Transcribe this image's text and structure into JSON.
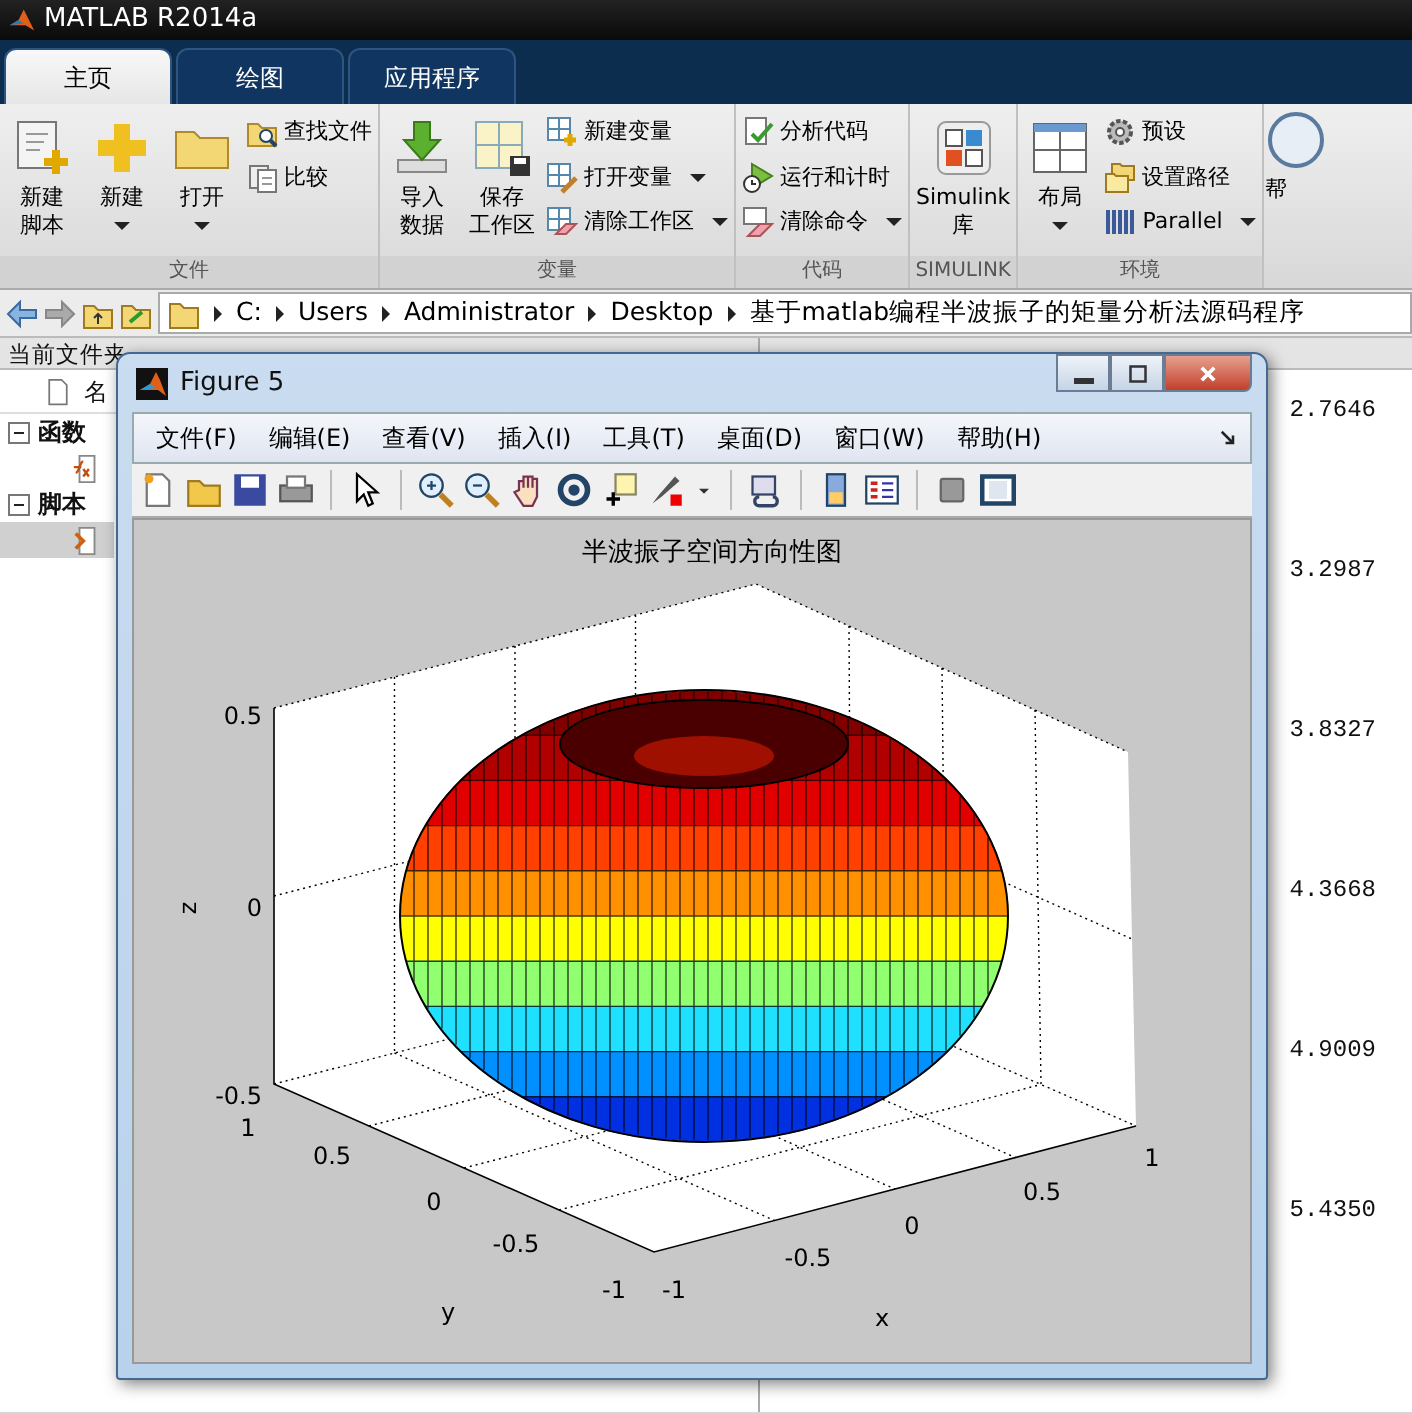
{
  "app_title": "MATLAB R2014a",
  "tabs": [
    {
      "label": "主页",
      "selected": true
    },
    {
      "label": "绘图",
      "selected": false
    },
    {
      "label": "应用程序",
      "selected": false
    }
  ],
  "ribbon": {
    "groups": [
      {
        "label": "文件",
        "columns": [
          [
            {
              "kind": "large",
              "lines": [
                "新建",
                "脚本"
              ],
              "dropdown": false
            }
          ],
          [
            {
              "kind": "large",
              "lines": [
                "新建"
              ],
              "dropdown": true
            }
          ],
          [
            {
              "kind": "large",
              "lines": [
                "打开"
              ],
              "dropdown": true
            }
          ],
          [
            {
              "kind": "small",
              "label": "查找文件",
              "dropdown": false
            },
            {
              "kind": "small",
              "label": "比较",
              "dropdown": false
            }
          ]
        ]
      },
      {
        "label": "变量",
        "columns": [
          [
            {
              "kind": "large",
              "lines": [
                "导入",
                "数据"
              ],
              "dropdown": false
            }
          ],
          [
            {
              "kind": "large",
              "lines": [
                "保存",
                "工作区"
              ],
              "dropdown": false
            }
          ],
          [
            {
              "kind": "small",
              "label": "新建变量",
              "dropdown": false
            },
            {
              "kind": "small",
              "label": "打开变量",
              "dropdown": true
            },
            {
              "kind": "small",
              "label": "清除工作区",
              "dropdown": true
            }
          ]
        ]
      },
      {
        "label": "代码",
        "columns": [
          [
            {
              "kind": "small",
              "label": "分析代码",
              "dropdown": false
            },
            {
              "kind": "small",
              "label": "运行和计时",
              "dropdown": false
            },
            {
              "kind": "small",
              "label": "清除命令",
              "dropdown": true
            }
          ]
        ]
      },
      {
        "label": "SIMULINK",
        "columns": [
          [
            {
              "kind": "large",
              "lines": [
                "Simulink",
                "库"
              ],
              "dropdown": false
            }
          ]
        ]
      },
      {
        "label": "环境",
        "columns": [
          [
            {
              "kind": "large",
              "lines": [
                "布局"
              ],
              "dropdown": true
            }
          ],
          [
            {
              "kind": "small",
              "label": "预设",
              "dropdown": false
            },
            {
              "kind": "small",
              "label": "设置路径",
              "dropdown": false
            },
            {
              "kind": "small",
              "label": "Parallel",
              "dropdown": true
            }
          ]
        ]
      }
    ],
    "cut_button": "帮"
  },
  "path": [
    "C:",
    "Users",
    "Administrator",
    "Desktop",
    "基于matlab编程半波振子的矩量分析法源码程序"
  ],
  "current_folder": {
    "title": "当前文件夹",
    "column": "名",
    "sections": [
      {
        "label": "函数",
        "expanded": true,
        "children": [
          {
            "kind": "function",
            "selected": false
          }
        ]
      },
      {
        "label": "脚本",
        "expanded": true,
        "children": [
          {
            "kind": "script",
            "selected": true
          }
        ]
      }
    ]
  },
  "command_window": {
    "values": [
      "2.7646",
      "3.2987",
      "3.8327",
      "4.3668",
      "4.9009",
      "5.4350"
    ]
  },
  "figure": {
    "title": "Figure 5",
    "menus": [
      "文件(F)",
      "编辑(E)",
      "查看(V)",
      "插入(I)",
      "工具(T)",
      "桌面(D)",
      "窗口(W)",
      "帮助(H)"
    ],
    "plot": {
      "title": "半波振子空间方向性图",
      "zlabel": "z",
      "ylabel": "y",
      "xlabel": "x",
      "zticks": [
        "0.5",
        "0",
        "-0.5"
      ],
      "yticks": [
        "1",
        "0.5",
        "0",
        "-0.5",
        "-1"
      ],
      "xticks": [
        "-1",
        "-0.5",
        "0",
        "0.5",
        "1"
      ]
    }
  }
}
